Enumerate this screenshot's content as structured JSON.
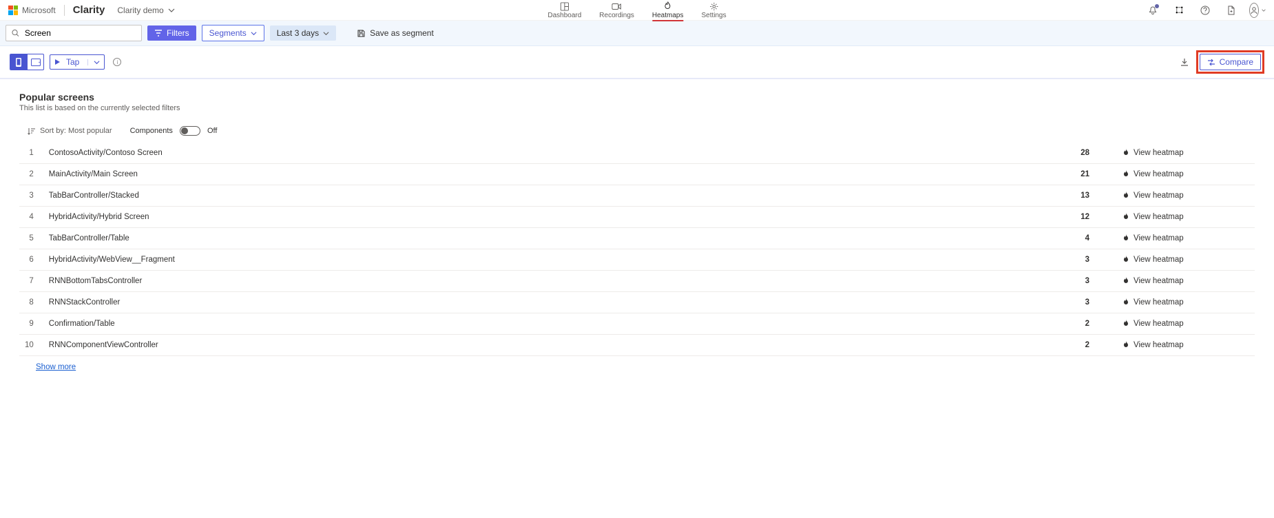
{
  "brand": {
    "microsoft": "Microsoft",
    "product": "Clarity",
    "project": "Clarity demo"
  },
  "nav": {
    "items": [
      {
        "label": "Dashboard",
        "active": false
      },
      {
        "label": "Recordings",
        "active": false
      },
      {
        "label": "Heatmaps",
        "active": true
      },
      {
        "label": "Settings",
        "active": false
      }
    ]
  },
  "filterbar": {
    "search_value": "Screen",
    "filters_label": "Filters",
    "segments_label": "Segments",
    "date_label": "Last 3 days",
    "save_segment_label": "Save as segment"
  },
  "subbar": {
    "tap_label": "Tap",
    "compare_label": "Compare"
  },
  "page": {
    "title": "Popular screens",
    "subtitle": "This list is based on the currently selected filters",
    "sort_label": "Sort by: Most popular",
    "components_label": "Components",
    "toggle_state": "Off",
    "view_heatmap_label": "View heatmap",
    "show_more": "Show more"
  },
  "rows": [
    {
      "name": "ContosoActivity/Contoso Screen",
      "count": 28
    },
    {
      "name": "MainActivity/Main Screen",
      "count": 21
    },
    {
      "name": "TabBarController/Stacked",
      "count": 13
    },
    {
      "name": "HybridActivity/Hybrid Screen",
      "count": 12
    },
    {
      "name": "TabBarController/Table",
      "count": 4
    },
    {
      "name": "HybridActivity/WebView__Fragment",
      "count": 3
    },
    {
      "name": "RNNBottomTabsController",
      "count": 3
    },
    {
      "name": "RNNStackController",
      "count": 3
    },
    {
      "name": "Confirmation/Table",
      "count": 2
    },
    {
      "name": "RNNComponentViewController",
      "count": 2
    }
  ]
}
